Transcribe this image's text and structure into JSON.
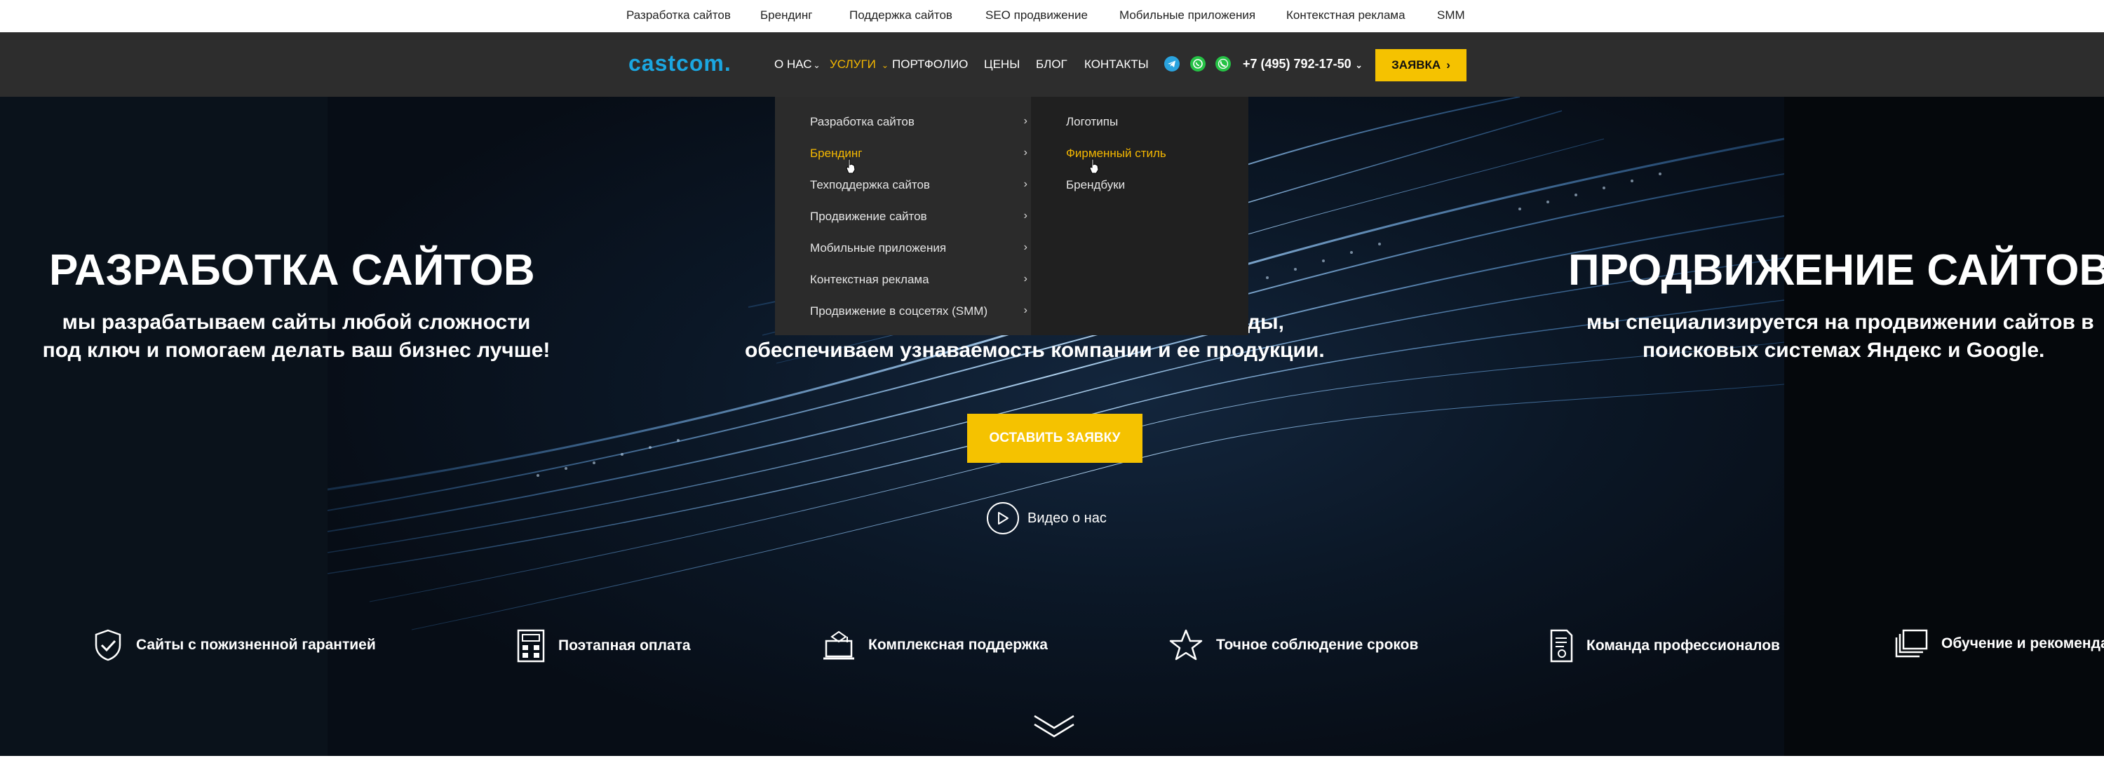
{
  "topbar": {
    "links": [
      "Разработка сайтов",
      "Брендинг",
      "Поддержка сайтов",
      "SEO продвижение",
      "Мобильные приложения",
      "Контекстная реклама",
      "SMM"
    ]
  },
  "header": {
    "logo": "castcom.",
    "nav": [
      "О НАС",
      "УСЛУГИ",
      "ПОРТФОЛИО",
      "ЦЕНЫ",
      "БЛОГ",
      "КОНТАКТЫ"
    ],
    "phone": "+7 (495) 792-17-50",
    "cta": "ЗАЯВКА",
    "icons": [
      "telegram-icon",
      "whatsapp-icon",
      "viber-icon"
    ]
  },
  "dropdown": {
    "services": [
      "Разработка сайтов",
      "Брендинг",
      "Техподдержка сайтов",
      "Продвижение сайтов",
      "Мобильные приложения",
      "Контекстная реклама",
      "Продвижение в соцсетях (SMM)"
    ],
    "branding_sub": [
      "Логотипы",
      "Фирменный стиль",
      "Брендбуки"
    ]
  },
  "hero": {
    "left_title": "РАЗРАБОТКА САЙТОВ",
    "left_sub_1": "мы разрабатываем сайты любой сложности",
    "left_sub_2": "под ключ и помогаем делать ваш бизнес лучше!",
    "center_sub_1_tail": "ды,",
    "center_sub_2": "обеспечиваем узнаваемость компании и ее продукции.",
    "right_title": "ПРОДВИЖЕНИЕ САЙТОВ",
    "right_sub_1": "мы  специализируется на продвижении сайтов в",
    "right_sub_2": "поисковых системах Яндекс и Google.",
    "cta": "ОСТАВИТЬ ЗАЯВКУ",
    "video": "Видео о нас"
  },
  "features": [
    {
      "label": "Сайты с пожизненной гарантией",
      "icon": "shield-check-icon"
    },
    {
      "label": "Поэтапная оплата",
      "icon": "calculator-icon"
    },
    {
      "label": "Комплексная поддержка",
      "icon": "laptop-support-icon"
    },
    {
      "label": "Точное соблюдение сроков",
      "icon": "star-icon"
    },
    {
      "label": "Команда профессионалов",
      "icon": "certificate-icon"
    },
    {
      "label": "Обучение и рекомендации",
      "icon": "books-icon"
    }
  ],
  "colors": {
    "accent": "#f5c200",
    "header": "#2d2d2d",
    "logo": "#1ba6e0"
  }
}
